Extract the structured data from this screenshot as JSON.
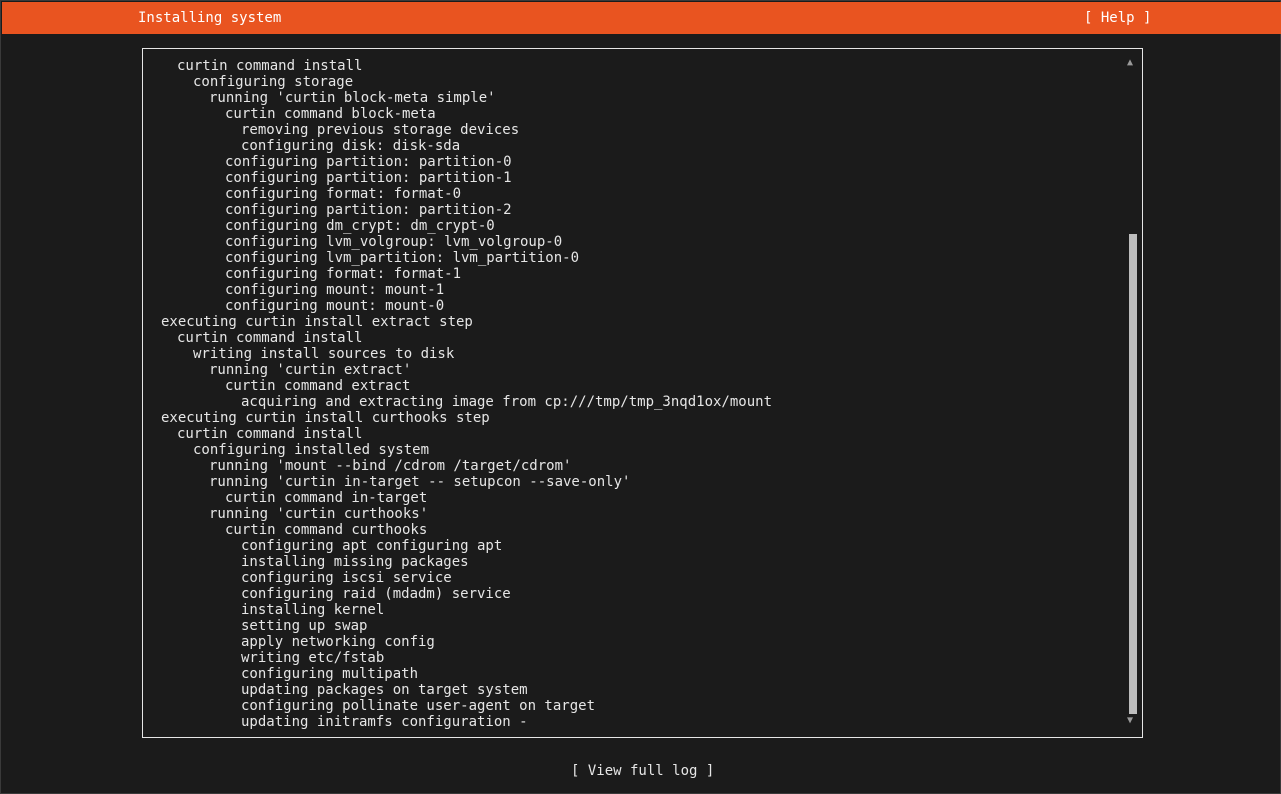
{
  "header": {
    "title": "Installing system",
    "help_label": "[ Help ]",
    "accent_color": "#e95420"
  },
  "log": {
    "lines": [
      {
        "indent": 1,
        "text": "curtin command install"
      },
      {
        "indent": 2,
        "text": "configuring storage"
      },
      {
        "indent": 3,
        "text": "running 'curtin block-meta simple'"
      },
      {
        "indent": 4,
        "text": "curtin command block-meta"
      },
      {
        "indent": 5,
        "text": "removing previous storage devices"
      },
      {
        "indent": 5,
        "text": "configuring disk: disk-sda"
      },
      {
        "indent": 4,
        "text": "configuring partition: partition-0"
      },
      {
        "indent": 4,
        "text": "configuring partition: partition-1"
      },
      {
        "indent": 4,
        "text": "configuring format: format-0"
      },
      {
        "indent": 4,
        "text": "configuring partition: partition-2"
      },
      {
        "indent": 4,
        "text": "configuring dm_crypt: dm_crypt-0"
      },
      {
        "indent": 4,
        "text": "configuring lvm_volgroup: lvm_volgroup-0"
      },
      {
        "indent": 4,
        "text": "configuring lvm_partition: lvm_partition-0"
      },
      {
        "indent": 4,
        "text": "configuring format: format-1"
      },
      {
        "indent": 4,
        "text": "configuring mount: mount-1"
      },
      {
        "indent": 4,
        "text": "configuring mount: mount-0"
      },
      {
        "indent": 0,
        "text": "executing curtin install extract step"
      },
      {
        "indent": 1,
        "text": "curtin command install"
      },
      {
        "indent": 2,
        "text": "writing install sources to disk"
      },
      {
        "indent": 3,
        "text": "running 'curtin extract'"
      },
      {
        "indent": 4,
        "text": "curtin command extract"
      },
      {
        "indent": 5,
        "text": "acquiring and extracting image from cp:///tmp/tmp_3nqd1ox/mount"
      },
      {
        "indent": 0,
        "text": "executing curtin install curthooks step"
      },
      {
        "indent": 1,
        "text": "curtin command install"
      },
      {
        "indent": 2,
        "text": "configuring installed system"
      },
      {
        "indent": 3,
        "text": "running 'mount --bind /cdrom /target/cdrom'"
      },
      {
        "indent": 3,
        "text": "running 'curtin in-target -- setupcon --save-only'"
      },
      {
        "indent": 4,
        "text": "curtin command in-target"
      },
      {
        "indent": 3,
        "text": "running 'curtin curthooks'"
      },
      {
        "indent": 4,
        "text": "curtin command curthooks"
      },
      {
        "indent": 5,
        "text": "configuring apt configuring apt"
      },
      {
        "indent": 5,
        "text": "installing missing packages"
      },
      {
        "indent": 5,
        "text": "configuring iscsi service"
      },
      {
        "indent": 5,
        "text": "configuring raid (mdadm) service"
      },
      {
        "indent": 5,
        "text": "installing kernel"
      },
      {
        "indent": 5,
        "text": "setting up swap"
      },
      {
        "indent": 5,
        "text": "apply networking config"
      },
      {
        "indent": 5,
        "text": "writing etc/fstab"
      },
      {
        "indent": 5,
        "text": "configuring multipath"
      },
      {
        "indent": 5,
        "text": "updating packages on target system"
      },
      {
        "indent": 5,
        "text": "configuring pollinate user-agent on target"
      },
      {
        "indent": 5,
        "text": "updating initramfs configuration -"
      }
    ],
    "scroll_up_icon": "scroll-up-arrow-icon",
    "scroll_down_icon": "scroll-down-arrow-icon"
  },
  "footer": {
    "view_log_label": "[ View full log ]"
  }
}
